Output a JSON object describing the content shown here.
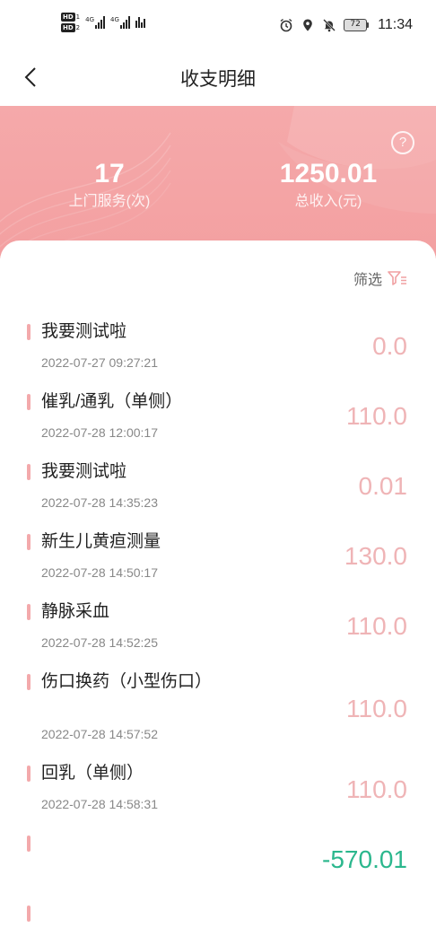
{
  "status_bar": {
    "sim1_label": "HD",
    "sim1_num": "1",
    "sim2_label": "HD",
    "sim2_num": "2",
    "net1": "4G",
    "net2": "4G",
    "battery": "72",
    "time": "11:34"
  },
  "nav": {
    "title": "收支明细",
    "back_icon": "chevron-left-icon"
  },
  "summary": {
    "service_count": "17",
    "service_label": "上门服务(次)",
    "total_income": "1250.01",
    "total_income_label": "总收入(元)",
    "help_icon": "question-circle-icon"
  },
  "filter": {
    "label": "筛选",
    "icon": "filter-icon"
  },
  "records": [
    {
      "title": "我要测试啦",
      "time": "2022-07-27 09:27:21",
      "amount": "0.0"
    },
    {
      "title": "催乳/通乳（单侧）",
      "time": "2022-07-28 12:00:17",
      "amount": "110.0"
    },
    {
      "title": "我要测试啦",
      "time": "2022-07-28 14:35:23",
      "amount": "0.01"
    },
    {
      "title": "新生儿黄疸测量",
      "time": "2022-07-28 14:50:17",
      "amount": "130.0"
    },
    {
      "title": "静脉采血",
      "time": "2022-07-28 14:52:25",
      "amount": "110.0"
    },
    {
      "title": "伤口换药（小型伤口）",
      "time": "2022-07-28 14:57:52",
      "amount": "110.0"
    },
    {
      "title": "回乳（单侧）",
      "time": "2022-07-28 14:58:31",
      "amount": "110.0"
    },
    {
      "title": "",
      "time": "",
      "amount": "-570.01"
    },
    {
      "title": "",
      "time": "",
      "amount": ""
    }
  ],
  "colors": {
    "header": "#f3a0a1",
    "accent_bar": "#f3a9ab",
    "amount_positive": "#efb4b6",
    "amount_negative": "#2bb78d"
  }
}
